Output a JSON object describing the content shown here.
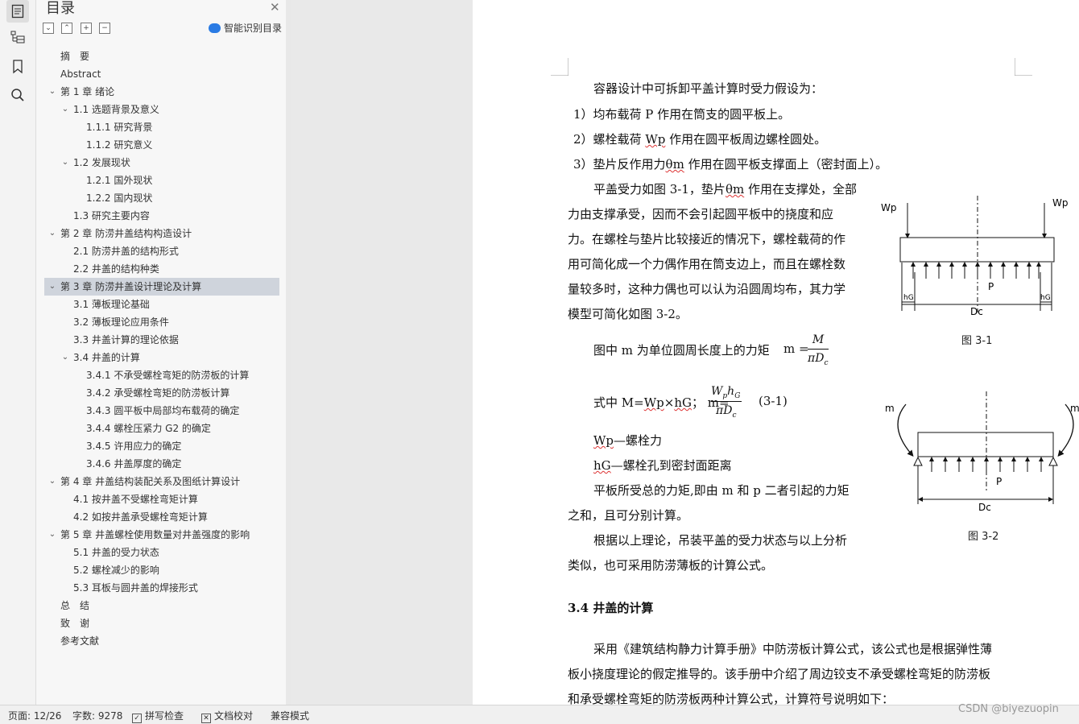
{
  "rail": {
    "icons": [
      "page-icon",
      "outline-icon",
      "bookmark-icon",
      "search-icon"
    ]
  },
  "toc": {
    "title": "目录",
    "smart_label": "智能识别目录",
    "items": [
      {
        "label": "摘　要",
        "level": 0,
        "caret": ""
      },
      {
        "label": "Abstract",
        "level": 0,
        "caret": ""
      },
      {
        "label": "第 1 章  绪论",
        "level": 0,
        "caret": "v"
      },
      {
        "label": "1.1 选题背景及意义",
        "level": 1,
        "caret": "v"
      },
      {
        "label": "1.1.1 研究背景",
        "level": 2,
        "caret": ""
      },
      {
        "label": "1.1.2 研究意义",
        "level": 2,
        "caret": ""
      },
      {
        "label": "1.2 发展现状",
        "level": 1,
        "caret": "v"
      },
      {
        "label": "1.2.1 国外现状",
        "level": 2,
        "caret": ""
      },
      {
        "label": "1.2.2 国内现状",
        "level": 2,
        "caret": ""
      },
      {
        "label": "1.3 研究主要内容",
        "level": 1,
        "caret": ""
      },
      {
        "label": "第 2 章  防涝井盖结构构造设计",
        "level": 0,
        "caret": "v"
      },
      {
        "label": "2.1 防涝井盖的结构形式",
        "level": 1,
        "caret": ""
      },
      {
        "label": "2.2 井盖的结构种类",
        "level": 1,
        "caret": ""
      },
      {
        "label": "第 3 章  防涝井盖设计理论及计算",
        "level": 0,
        "caret": "v",
        "selected": true
      },
      {
        "label": "3.1 薄板理论基础",
        "level": 1,
        "caret": ""
      },
      {
        "label": "3.2 薄板理论应用条件",
        "level": 1,
        "caret": ""
      },
      {
        "label": "3.3 井盖计算的理论依据",
        "level": 1,
        "caret": ""
      },
      {
        "label": "3.4 井盖的计算",
        "level": 1,
        "caret": "v"
      },
      {
        "label": "3.4.1 不承受螺栓弯矩的防涝板的计算",
        "level": 2,
        "caret": ""
      },
      {
        "label": "3.4.2 承受螺栓弯矩的防涝板计算",
        "level": 2,
        "caret": ""
      },
      {
        "label": "3.4.3 圆平板中局部均布载荷的确定",
        "level": 2,
        "caret": ""
      },
      {
        "label": "3.4.4 螺栓压紧力 G2 的确定",
        "level": 2,
        "caret": ""
      },
      {
        "label": "3.4.5  许用应力的确定",
        "level": 2,
        "caret": ""
      },
      {
        "label": "3.4.6  井盖厚度的确定",
        "level": 2,
        "caret": ""
      },
      {
        "label": "第 4 章  井盖结构装配关系及图纸计算设计",
        "level": 0,
        "caret": "v"
      },
      {
        "label": "4.1 按井盖不受螺栓弯矩计算",
        "level": 1,
        "caret": ""
      },
      {
        "label": "4.2 如按井盖承受螺栓弯矩计算",
        "level": 1,
        "caret": ""
      },
      {
        "label": "第 5 章  井盖螺栓使用数量对井盖强度的影响",
        "level": 0,
        "caret": "v"
      },
      {
        "label": "5.1 井盖的受力状态",
        "level": 1,
        "caret": ""
      },
      {
        "label": "5.2 螺栓减少的影响",
        "level": 1,
        "caret": ""
      },
      {
        "label": "5.3 耳板与圆井盖的焊接形式",
        "level": 1,
        "caret": ""
      },
      {
        "label": "总　结",
        "level": 0,
        "caret": ""
      },
      {
        "label": "致　谢",
        "level": 0,
        "caret": ""
      },
      {
        "label": "参考文献",
        "level": 0,
        "caret": ""
      }
    ]
  },
  "doc": {
    "l1": "容器设计中可拆卸平盖计算时受力假设为：",
    "l2a": "1）均布载荷 P 作用在筒支的圆平板上。",
    "l3a": "2）螺栓载荷 ",
    "l3b": "Wp",
    "l3c": " 作用在圆平板周边螺栓圆处。",
    "l4a": "3）垫片反作用力",
    "l4b": "θm",
    "l4c": " 作用在圆平板支撑面上（密封面上）。",
    "l5a": "平盖受力如图 3-1，垫片",
    "l5b": "θm",
    "l5c": " 作用在支撑处，全部",
    "l6": "力由支撑承受，因而不会引起圆平板中的挠度和应",
    "l7": "力。在螺栓与垫片比较接近的情况下，螺栓载荷的作",
    "l8": "用可简化成一个力偶作用在筒支边上，而且在螺栓数",
    "l9": "量较多时，这种力偶也可以认为沿圆周均布，其力学",
    "l10": "模型可简化如图 3-2。",
    "l11": "图中 m 为单位圆周长度上的力矩",
    "f1_lhs": "m =",
    "f1_num": "M",
    "f1_den": "πD",
    "f1_sub": "c",
    "l12a": "式中 M=",
    "l12b": "Wp",
    "l12c": "×",
    "l12d": "hG",
    "l12e": "；  m=",
    "f2_num_a": "W",
    "f2_num_b": "p",
    "f2_num_c": "h",
    "f2_num_d": "G",
    "f2_den": "πD",
    "f2_sub": "c",
    "eq_no": "(3-1)",
    "l13a": "Wp",
    "l13b": "—螺栓力",
    "l14a": "hG",
    "l14b": "—螺栓孔到密封面距离",
    "l15": "平板所受总的力矩,即由 m 和 p 二者引起的力矩",
    "l16": "之和，且可分别计算。",
    "l17": "根据以上理论，吊装平盖的受力状态与以上分析",
    "l18": "类似，也可采用防涝薄板的计算公式。",
    "h34": "3.4 井盖的计算",
    "l19": "采用《建筑结构静力计算手册》中防涝板计算公式，该公式也是根据弹性薄",
    "l20": "板小挠度理论的假定推导的。该手册中介绍了周边铰支不承受螺栓弯矩的防涝板",
    "l21": "和承受螺栓弯矩的防涝板两种计算公式，计算符号说明如下："
  },
  "fig31": {
    "caption": "图 3-1",
    "wp_left": "Wp",
    "wp_right": "Wp",
    "p": "P",
    "hg_left": "hG",
    "hg_right": "hG",
    "dc": "Dc"
  },
  "fig32": {
    "caption": "图 3-2",
    "m_left": "m",
    "m_right": "m",
    "p": "P",
    "dc": "Dc"
  },
  "status": {
    "page": "页面: 12/26",
    "words": "字数: 9278",
    "spell": "拼写检查",
    "proof": "文档校对",
    "compat": "兼容模式"
  },
  "watermark": "CSDN @biyezuopin"
}
